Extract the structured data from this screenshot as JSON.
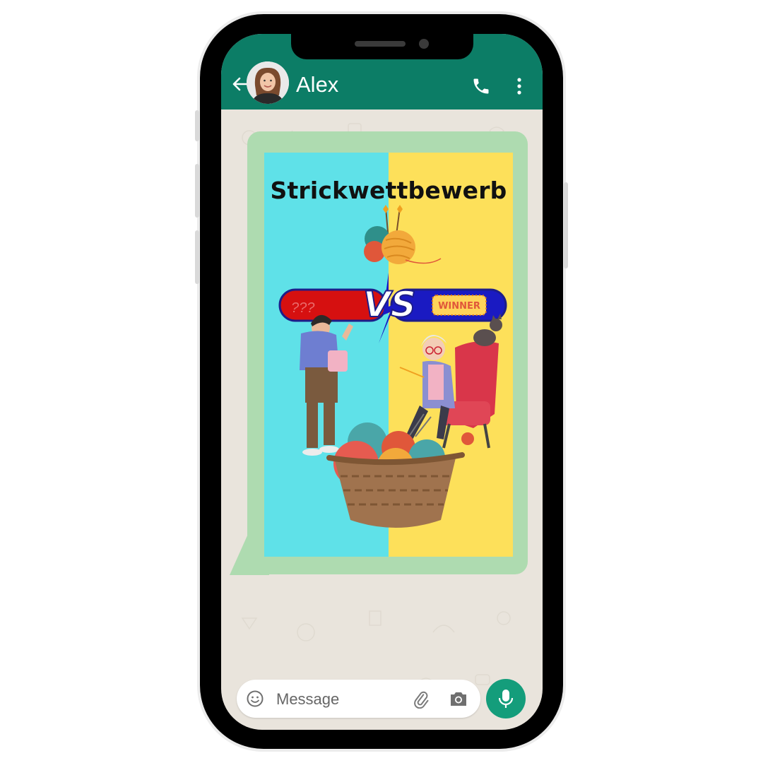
{
  "chat": {
    "contact_name": "Alex",
    "back_icon": "arrow-left-icon",
    "call_icon": "phone-icon",
    "menu_icon": "more-vertical-icon"
  },
  "message": {
    "poster_title": "Strickwettbewerb",
    "vs_text": "VS",
    "badge_text": "WINNER",
    "question_marks": "???"
  },
  "composer": {
    "placeholder": "Message",
    "emoji_icon": "emoji-icon",
    "attach_icon": "paperclip-icon",
    "camera_icon": "camera-icon",
    "mic_icon": "microphone-icon"
  },
  "colors": {
    "header": "#0c7d66",
    "bubble": "#aedbb0",
    "poster_left": "#5fe1e8",
    "poster_right": "#fde05a",
    "mic_button": "#149d7b"
  }
}
